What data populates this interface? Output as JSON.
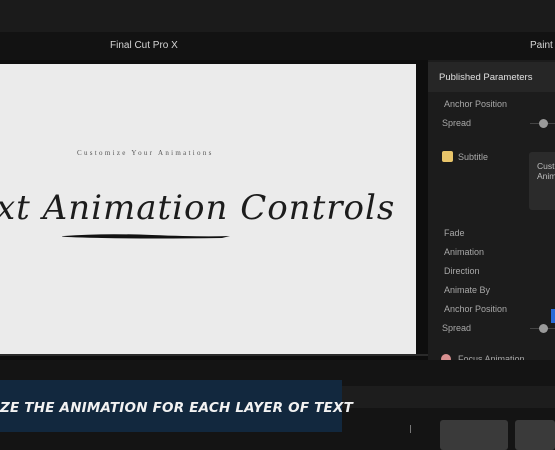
{
  "window": {
    "title": "Final Cut Pro X",
    "right_tab": "Paint"
  },
  "viewer": {
    "small_caption": "Customize Your Animations",
    "script_title": "xt Animation Controls"
  },
  "inspector": {
    "header": "Published Parameters",
    "params_top": [
      "Anchor Position",
      "Spread"
    ],
    "subtitle_label": "Subtitle",
    "subtitle_text_lines": [
      "Cust",
      "Anim"
    ],
    "params_bottom": [
      "Fade",
      "Animation",
      "Direction",
      "Animate By",
      "Anchor Position",
      "Spread"
    ],
    "focus_label": "Focus Animation"
  },
  "lower_third": {
    "text": "ZE THE ANIMATION FOR EACH LAYER OF TEXT"
  },
  "colors": {
    "accent_blue": "#2a6bd8",
    "lower_third_bg": "#12283e",
    "checkbox": "#e8c56a"
  }
}
